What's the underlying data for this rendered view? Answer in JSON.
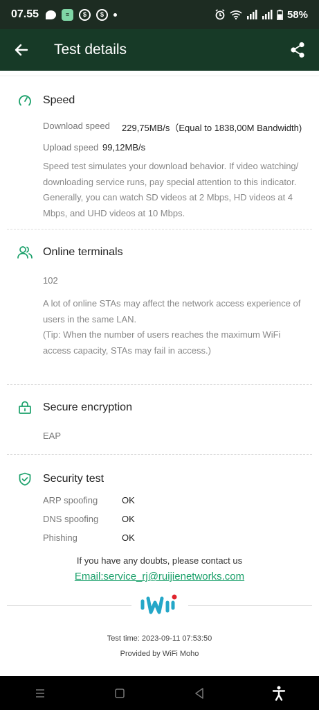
{
  "status_bar": {
    "time": "07.55",
    "battery": "58%"
  },
  "app_bar": {
    "title": "Test details"
  },
  "speed": {
    "title": "Speed",
    "rows": [
      {
        "label": "Download speed",
        "value": "229,75MB/s（Equal to 1838,00M Bandwidth)"
      },
      {
        "label": "Upload speed",
        "value": "99,12MB/s"
      }
    ],
    "description": "Speed test simulates your download behavior. If video watching/ downloading service runs, pay special attention to this indicator. Generally, you can watch SD videos at 2 Mbps, HD videos at 4 Mbps, and UHD videos at 10 Mbps."
  },
  "online_terminals": {
    "title": "Online terminals",
    "count": "102",
    "description": "A lot of online STAs may affect the network access experience of users in the same LAN.",
    "tip": "(Tip: When the number of users reaches the maximum WiFi access capacity, STAs may fail in access.)"
  },
  "secure_encryption": {
    "title": "Secure encryption",
    "value": "EAP"
  },
  "security_test": {
    "title": "Security test",
    "rows": [
      {
        "label": "ARP spoofing",
        "value": "OK"
      },
      {
        "label": "DNS spoofing",
        "value": "OK"
      },
      {
        "label": "Phishing",
        "value": "OK"
      }
    ]
  },
  "footer": {
    "contact_text": "If you have any doubts, please contact us",
    "email_link": "Email:service_rj@ruijienetworks.com",
    "test_time": "Test time: 2023-09-11 07:53:50",
    "provided_by": "Provided by WiFi Moho"
  },
  "colors": {
    "accent": "#1aa06a",
    "app_bar": "#173a27",
    "status_bar": "#1d2c22",
    "logo_blue": "#25a7c8",
    "logo_red": "#e0242d"
  }
}
